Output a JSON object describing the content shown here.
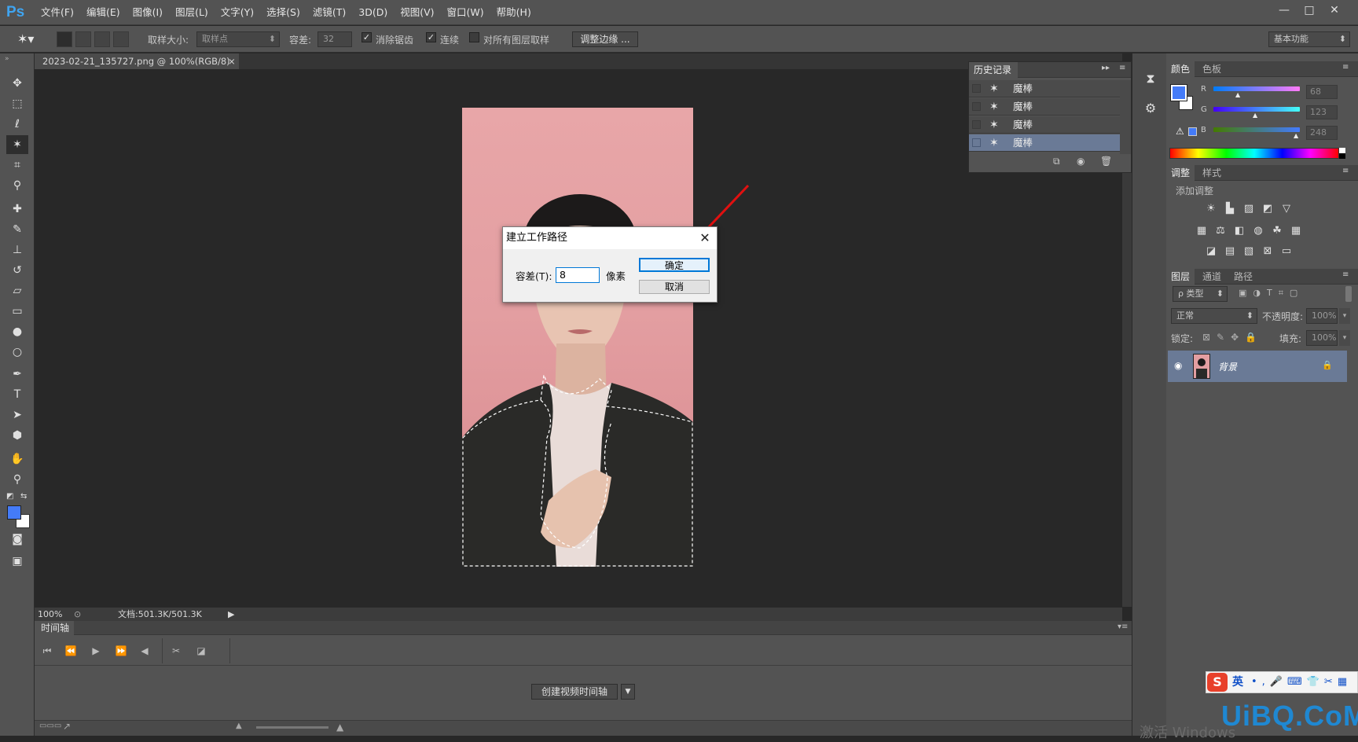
{
  "app": {
    "logo": "Ps"
  },
  "menu": [
    "文件(F)",
    "编辑(E)",
    "图像(I)",
    "图层(L)",
    "文字(Y)",
    "选择(S)",
    "滤镜(T)",
    "3D(D)",
    "视图(V)",
    "窗口(W)",
    "帮助(H)"
  ],
  "window_controls": {
    "minimize": "—",
    "restore": "□",
    "close": "✕"
  },
  "options": {
    "sample_size_label": "取样大小:",
    "sample_size_value": "取样点",
    "tolerance_label": "容差:",
    "tolerance_value": "32",
    "antialias_label": "消除锯齿",
    "contiguous_label": "连续",
    "all_layers_label": "对所有图层取样",
    "refine_edge_label": "调整边缘 ...",
    "workspace": "基本功能"
  },
  "document": {
    "tab_title": "2023-02-21_135727.png @ 100%(RGB/8)",
    "close": "×"
  },
  "status": {
    "zoom": "100%",
    "doc_size": "文档:501.3K/501.3K"
  },
  "history": {
    "title": "历史记录",
    "items": [
      "魔棒",
      "魔棒",
      "魔棒",
      "魔棒"
    ],
    "active_index": 3
  },
  "timeline": {
    "title": "时间轴",
    "create_button": "创建视频时间轴"
  },
  "color_panel": {
    "tabs": [
      "颜色",
      "色板"
    ],
    "channels": [
      {
        "label": "R",
        "value": "68"
      },
      {
        "label": "G",
        "value": "123"
      },
      {
        "label": "B",
        "value": "248"
      }
    ],
    "foreground": "#447bf8",
    "background": "#ffffff"
  },
  "adjust_panel": {
    "tabs": [
      "调整",
      "样式"
    ],
    "subtitle": "添加调整"
  },
  "layers_panel": {
    "tabs": [
      "图层",
      "通道",
      "路径"
    ],
    "filter_label": "ρ 类型",
    "blend_mode": "正常",
    "opacity_label": "不透明度:",
    "opacity_value": "100%",
    "lock_label": "锁定:",
    "fill_label": "填充:",
    "fill_value": "100%",
    "layer_name": "背景"
  },
  "dialog": {
    "title": "建立工作路径",
    "tolerance_label": "容差(T):",
    "tolerance_value": "8",
    "unit": "像素",
    "ok": "确定",
    "cancel": "取消",
    "close": "✕"
  },
  "ime": {
    "lang": "英"
  },
  "watermark": {
    "text": "UiBQ.CoM",
    "activate": "激活 Windows"
  }
}
